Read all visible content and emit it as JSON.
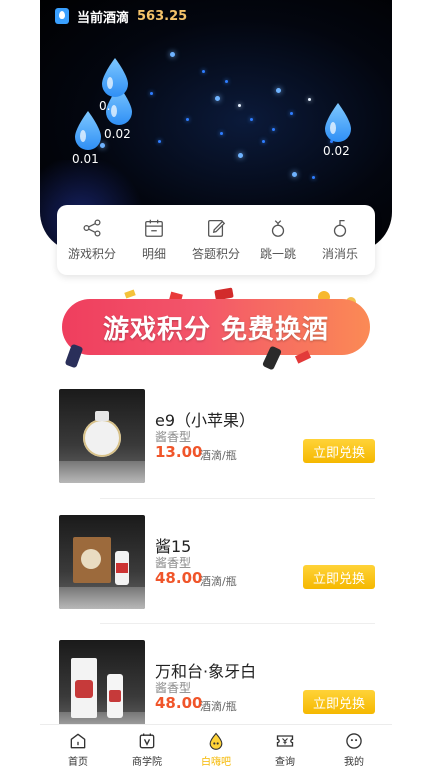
{
  "header": {
    "balance_label": "当前酒滴",
    "balance_value": "563.25",
    "drops": [
      {
        "value": "0.01"
      },
      {
        "value": "0.02"
      },
      {
        "value": "0."
      },
      {
        "value": "0.02"
      }
    ]
  },
  "actions": [
    {
      "label": "游戏积分",
      "icon": "share-icon"
    },
    {
      "label": "明细",
      "icon": "calendar-icon"
    },
    {
      "label": "答题积分",
      "icon": "edit-icon"
    },
    {
      "label": "跳一跳",
      "icon": "game-jump-icon"
    },
    {
      "label": "消消乐",
      "icon": "game-match-icon"
    }
  ],
  "banner": {
    "text": "游戏积分 免费换酒"
  },
  "products": [
    {
      "name": "e9（小苹果）",
      "type": "酱香型",
      "price": "13.00",
      "unit": "酒滴/瓶",
      "button": "立即兑换"
    },
    {
      "name": "酱15",
      "type": "酱香型",
      "price": "48.00",
      "unit": "酒滴/瓶",
      "button": "立即兑换"
    },
    {
      "name": "万和台·象牙白",
      "type": "酱香型",
      "price": "48.00",
      "unit": "酒滴/瓶",
      "button": "立即兑换"
    }
  ],
  "tabbar": [
    {
      "label": "首页",
      "icon": "home-icon"
    },
    {
      "label": "商学院",
      "icon": "academy-icon"
    },
    {
      "label": "白嗨吧",
      "icon": "drop-icon",
      "active": true
    },
    {
      "label": "查询",
      "icon": "ticket-icon"
    },
    {
      "label": "我的",
      "icon": "profile-icon"
    }
  ],
  "colors": {
    "accent": "#f5b800",
    "price": "#f0552a",
    "banner_start": "#ef3e5e",
    "banner_end": "#fb8a55",
    "drop": "#3aa0ff"
  }
}
